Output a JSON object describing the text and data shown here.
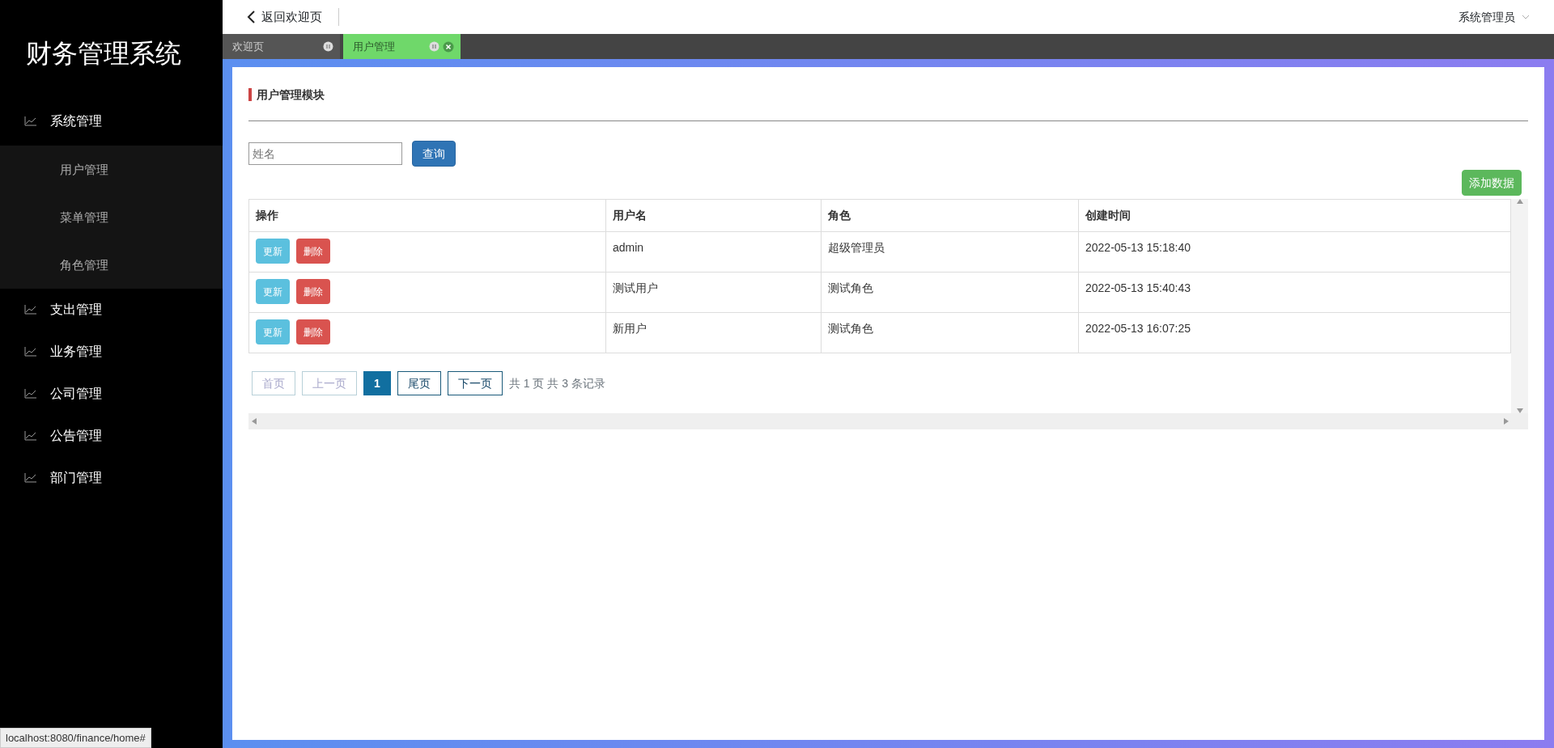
{
  "sidebar": {
    "title": "财务管理系统",
    "items": [
      {
        "label": "系统管理",
        "expanded": true,
        "children": [
          {
            "label": "用户管理"
          },
          {
            "label": "菜单管理"
          },
          {
            "label": "角色管理"
          }
        ]
      },
      {
        "label": "支出管理",
        "expanded": false
      },
      {
        "label": "业务管理",
        "expanded": false
      },
      {
        "label": "公司管理",
        "expanded": false
      },
      {
        "label": "公告管理",
        "expanded": false
      },
      {
        "label": "部门管理",
        "expanded": false
      }
    ]
  },
  "topbar": {
    "back_link": "返回欢迎页",
    "user_menu": "系统管理员"
  },
  "tabs": [
    {
      "label": "欢迎页",
      "selected": false,
      "closable": false
    },
    {
      "label": "用户管理",
      "selected": true,
      "closable": true
    }
  ],
  "panel": {
    "title": "用户管理模块",
    "search": {
      "placeholder": "姓名",
      "button": "查询"
    },
    "add_button": "添加数据",
    "table": {
      "columns": [
        "操作",
        "用户名",
        "角色",
        "创建时间"
      ],
      "rows": [
        {
          "actions": [
            "更新",
            "删除"
          ],
          "username": "admin",
          "role": "超级管理员",
          "created": "2022-05-13 15:18:40"
        },
        {
          "actions": [
            "更新",
            "删除"
          ],
          "username": "测试用户",
          "role": "测试角色",
          "created": "2022-05-13 15:40:43"
        },
        {
          "actions": [
            "更新",
            "删除"
          ],
          "username": "新用户",
          "role": "测试角色",
          "created": "2022-05-13 16:07:25"
        }
      ]
    },
    "pagination": {
      "pages": [
        {
          "label": "首页",
          "disabled": true,
          "selected": false
        },
        {
          "label": "上一页",
          "disabled": true,
          "selected": false
        },
        {
          "label": "1",
          "disabled": false,
          "selected": true
        },
        {
          "label": "尾页",
          "disabled": false,
          "selected": false
        },
        {
          "label": "下一页",
          "disabled": false,
          "selected": false
        }
      ],
      "summary": "共 1 页 共 3 条记录"
    }
  },
  "status_bar": "localhost:8080/finance/home#"
}
